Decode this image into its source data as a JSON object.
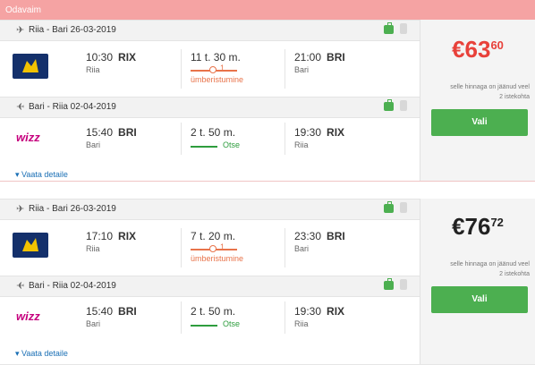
{
  "banner": {
    "label": "Odavaim"
  },
  "results": [
    {
      "outbound": {
        "route": "Riia - Bari 26-03-2019",
        "airline_icon": "ryanair-logo",
        "dep_time": "10:30",
        "dep_code": "RIX",
        "dep_city": "Riia",
        "duration": "11 t. 30 m.",
        "stops": "1",
        "stops_label": "ümberistumine",
        "arr_time": "21:00",
        "arr_code": "BRI",
        "arr_city": "Bari"
      },
      "inbound": {
        "route": "Bari - Riia 02-04-2019",
        "airline_icon": "wizzair-logo",
        "dep_time": "15:40",
        "dep_code": "BRI",
        "dep_city": "Bari",
        "duration": "2 t. 50 m.",
        "direct_label": "Otse",
        "arr_time": "19:30",
        "arr_code": "RIX",
        "arr_city": "Riia"
      },
      "details_label": "Vaata detaile",
      "price_main": "€63",
      "price_cents": "60",
      "price_color": "#e8413a",
      "note_line1": "selle hinnaga on jäänud veel",
      "note_line2": "2 istekohta",
      "button_label": "Vali"
    },
    {
      "outbound": {
        "route": "Riia - Bari 26-03-2019",
        "airline_icon": "ryanair-logo",
        "dep_time": "17:10",
        "dep_code": "RIX",
        "dep_city": "Riia",
        "duration": "7 t. 20 m.",
        "stops": "1",
        "stops_label": "ümberistumine",
        "arr_time": "23:30",
        "arr_code": "BRI",
        "arr_city": "Bari"
      },
      "inbound": {
        "route": "Bari - Riia 02-04-2019",
        "airline_icon": "wizzair-logo",
        "dep_time": "15:40",
        "dep_code": "BRI",
        "dep_city": "Bari",
        "duration": "2 t. 50 m.",
        "direct_label": "Otse",
        "arr_time": "19:30",
        "arr_code": "RIX",
        "arr_city": "Riia"
      },
      "details_label": "Vaata detaile",
      "price_main": "€76",
      "price_cents": "72",
      "price_color": "#222222",
      "note_line1": "selle hinnaga on jäänud veel",
      "note_line2": "2 istekohta",
      "button_label": "Vali"
    }
  ]
}
